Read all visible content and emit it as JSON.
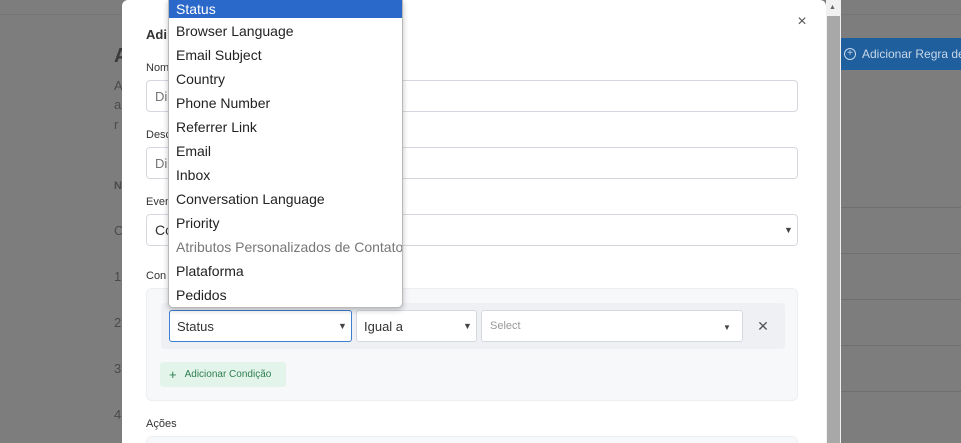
{
  "background": {
    "heading": "A",
    "desc_chars": [
      "A",
      "a",
      "r"
    ],
    "column_initial": "N",
    "row_initials": [
      "C",
      "1",
      "2",
      "3",
      "4"
    ],
    "add_rule_button": "Adicionar Regra de"
  },
  "modal": {
    "title": "Adi",
    "name_label": "Nom",
    "name_placeholder": "Di",
    "description_label": "Desc",
    "description_placeholder": "Di",
    "event_label": "Even",
    "event_value": "Co",
    "conditions_label": "Con",
    "condition": {
      "attribute": "Status",
      "operator": "Igual a",
      "value_placeholder": "Select"
    },
    "add_condition": "Adicionar Condição",
    "actions_label": "Ações"
  },
  "dropdown": {
    "items": [
      "Status",
      "Browser Language",
      "Email Subject",
      "Country",
      "Phone Number",
      "Referrer Link",
      "Email",
      "Inbox",
      "Conversation Language",
      "Priority",
      "Atributos Personalizados de Contato",
      "Plataforma",
      "Pedidos"
    ]
  },
  "colors": {
    "accent": "#2a68c9",
    "overlay": "#7d7d7d",
    "add_condition_bg": "#e3f5ea"
  }
}
